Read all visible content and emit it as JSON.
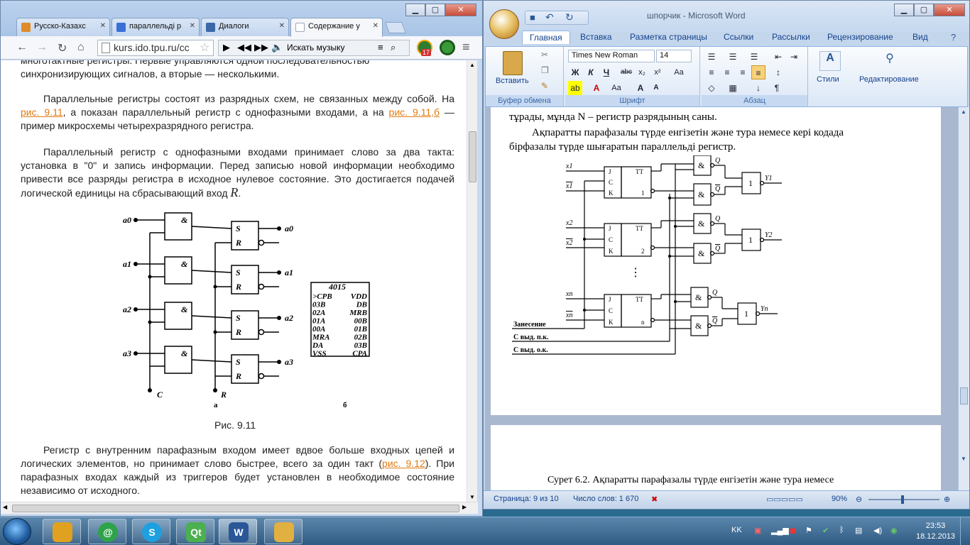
{
  "browser": {
    "tabs": [
      {
        "label": "Русско-Казахс",
        "color": "#e08a2a"
      },
      {
        "label": "параллельді р",
        "color": "#3b6fd8"
      },
      {
        "label": "Диалоги",
        "color": "#3a68a8"
      },
      {
        "label": "Содержание у",
        "color": "#9aa7b8"
      }
    ],
    "url": "kurs.ido.tpu.ru/cc",
    "music_search": "Искать музыку",
    "badge": "17",
    "partial_line_1": "многотактные регистры. Первые управляются одной последовательностью",
    "partial_line_2": "синхронизирующих сигналов, а вторые — несколькими.",
    "para1_a": "Параллельные регистры состоят из разрядных схем, не связанных между собой. На ",
    "para1_link1": "рис. 9.11",
    "para1_b": ", а показан параллельный регистр с однофазными входами, а на ",
    "para1_link2": "рис. 9.11,б",
    "para1_c": " — пример микросхемы четырехразрядного регистра.",
    "para2": "Параллельный регистр с однофазными входами принимает слово за два такта: установка в \"0\" и запись информации. Перед записью новой информации необходимо привести все разряды регистра в исходное нулевое состояние. Это достигается подачей логической единицы на сбрасывающий вход ",
    "para2_R": "R",
    "para2_end": ".",
    "fig_a_label": "а",
    "fig_b_label": "б",
    "fig_caption": "Рис. 9.11",
    "para3_a": "Регистр с внутренним парафазным входом имеет вдвое больше входных цепей и логических элементов, но принимает слово быстрее, всего за один такт (",
    "para3_link": "рис. 9.12",
    "para3_b": "). При парафазных входах каждый из триггеров будет установлен в необходимое состояние независимо от исходного.",
    "circuit": {
      "inputs": [
        "a0",
        "a1",
        "a2",
        "a3"
      ],
      "outputs": [
        "a0",
        "a1",
        "a2",
        "a3"
      ],
      "and_symbol": "&",
      "S": "S",
      "R": "R",
      "C": "C"
    },
    "chip": {
      "name": "4015",
      "left": [
        ">CPB",
        "03B",
        "02A",
        "01A",
        "00A",
        "MRA",
        "DA",
        "VSS"
      ],
      "right": [
        "VDD",
        "DB",
        "MRB",
        "00B",
        "01B",
        "02B",
        "03B",
        "CPA"
      ]
    }
  },
  "word": {
    "title": "шпорчик - Microsoft Word",
    "tabs": [
      "Главная",
      "Вставка",
      "Разметка страницы",
      "Ссылки",
      "Рассылки",
      "Рецензирование",
      "Вид"
    ],
    "paste_label": "Вставить",
    "clipboard_group": "Буфер обмена",
    "font_name": "Times New Roman",
    "font_size": "14",
    "font_group": "Шрифт",
    "para_group": "Абзац",
    "styles_label": "Стили",
    "editing_label": "Редактирование",
    "doc_line1": "тұрады, мұнда  N – регистр разрядының саны.",
    "doc_line2": "Ақпаратты парафазалы түрде енгізетін және тура немесе кері кодада",
    "doc_line3": "бірфазалы түрде шығаратын  параллельді регистр.",
    "doc_line_page2": "Сурет 6.2. Ақпаратты парафазалы түрде енгізетін және тура немесе",
    "circuit": {
      "x": [
        "x1",
        "x1",
        "x2",
        "x2",
        "xn",
        "xn"
      ],
      "trig_labels": [
        "J",
        "C",
        "K",
        "TT"
      ],
      "trig_nums": [
        "1",
        "2",
        "n"
      ],
      "q": [
        "Q",
        "Q"
      ],
      "out": [
        "Y1",
        "Y2",
        "Yn"
      ],
      "and_symbol": "&",
      "or_symbol": "1",
      "dots": "⋮",
      "control": [
        "Занесение",
        "С выд. п.к.",
        "С выд. о.к."
      ]
    },
    "status_page": "Страница: 9 из 10",
    "status_words": "Число слов: 1 670",
    "zoom": "90%"
  },
  "taskbar": {
    "lang": "KK",
    "time": "23:53",
    "date": "18.12.2013",
    "apps": [
      {
        "name": "Chrome",
        "color": "#e0a020"
      },
      {
        "name": "Mail",
        "color": "#2ea34a"
      },
      {
        "name": "Skype",
        "color": "#1ea0e0"
      },
      {
        "name": "Qt",
        "color": "#4caf50"
      },
      {
        "name": "Word",
        "color": "#2b5797"
      },
      {
        "name": "Explorer",
        "color": "#e0b040"
      }
    ]
  }
}
